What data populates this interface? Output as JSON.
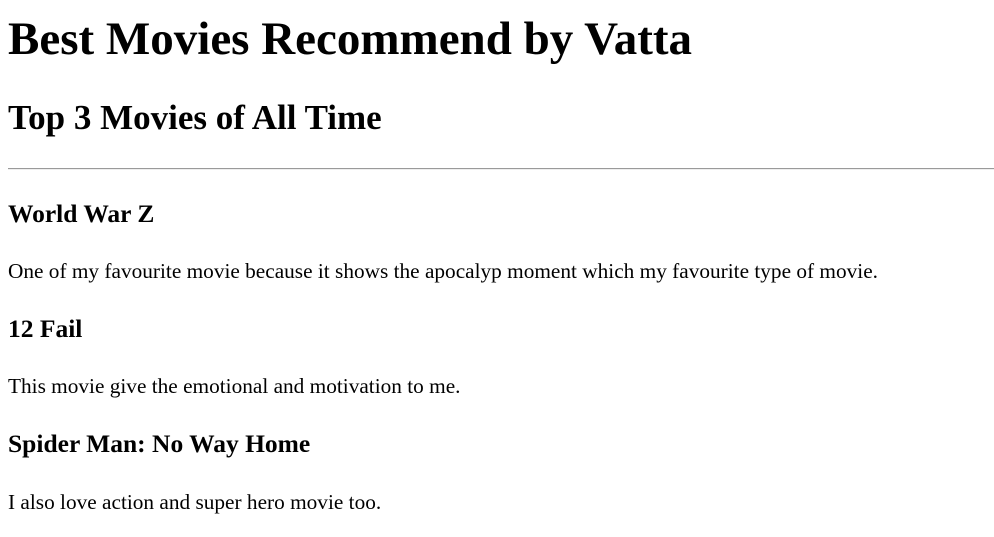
{
  "page": {
    "title": "Best Movies Recommend by Vatta",
    "subtitle": "Top 3 Movies of All Time"
  },
  "movies": [
    {
      "title": "World War Z",
      "description": "One of my favourite movie because it shows the apocalyp moment which my favourite type of movie."
    },
    {
      "title": "12 Fail",
      "description": "This movie give the emotional and motivation to me."
    },
    {
      "title": "Spider Man: No Way Home",
      "description": "I also love action and super hero movie too."
    }
  ]
}
